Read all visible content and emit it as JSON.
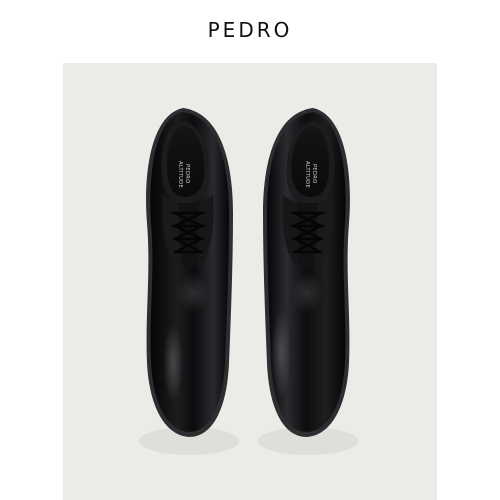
{
  "header": {
    "brand": "PEDRO"
  },
  "product_image": {
    "icon": "dress-shoes-image",
    "background_color": "#ecebe8",
    "shoe_color": "#0b0b0c",
    "left_shoe": {
      "insole_line1": "ALTITUDE",
      "insole_line2": "PEDRO"
    },
    "right_shoe": {
      "insole_line1": "ALTITUDE",
      "insole_line2": "PEDRO"
    }
  }
}
